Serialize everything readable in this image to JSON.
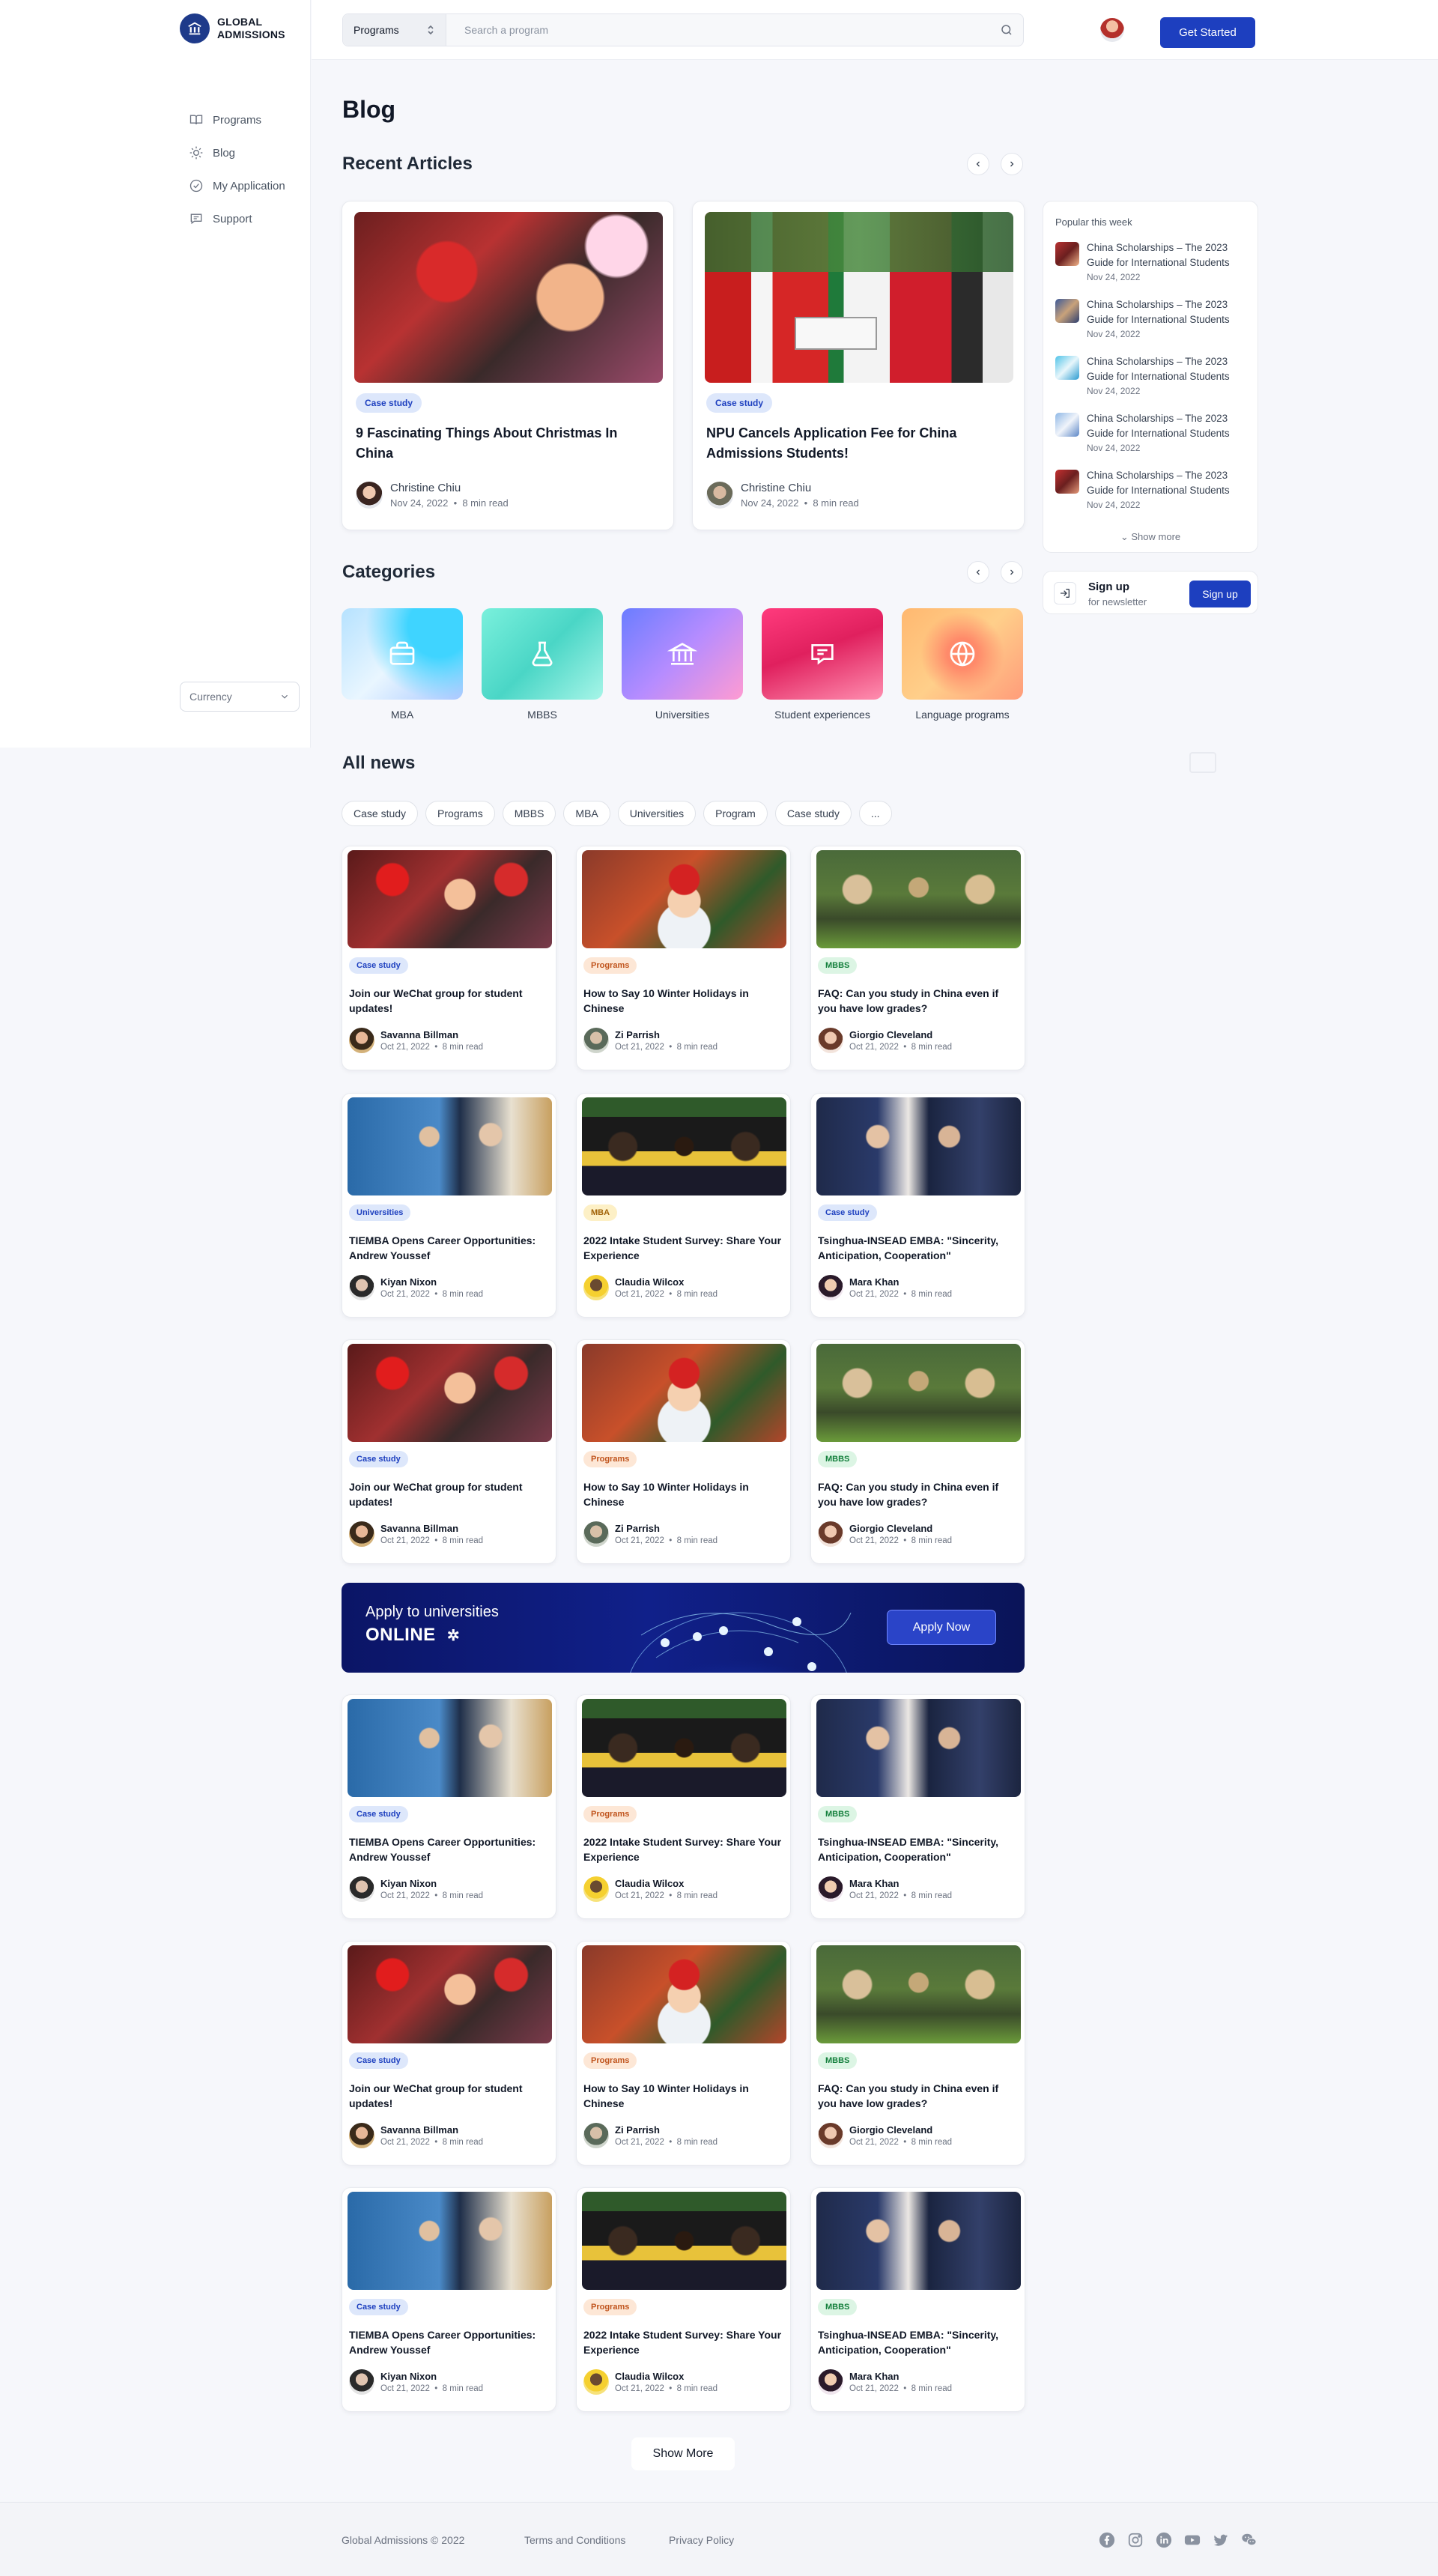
{
  "brand": {
    "line1": "GLOBAL",
    "line2": "ADMISSIONS",
    "color": "#1e3a8a"
  },
  "sidebar": {
    "items": [
      {
        "label": "Programs",
        "icon": "book-icon"
      },
      {
        "label": "Blog",
        "icon": "sun-icon"
      },
      {
        "label": "My Application",
        "icon": "check-circle-icon"
      },
      {
        "label": "Support",
        "icon": "chat-icon"
      }
    ],
    "currency": "Currency"
  },
  "header": {
    "search_select": "Programs",
    "search_placeholder": "Search a program",
    "cta": "Get Started",
    "accent": "#1d3fbf"
  },
  "page_title": "Blog",
  "recent": {
    "heading": "Recent Articles",
    "articles": [
      {
        "tag": "Case study",
        "title": "9 Fascinating Things About Christmas In China",
        "author": "Christine Chiu",
        "date": "Nov 24, 2022",
        "read": "8 min read"
      },
      {
        "tag": "Case study",
        "title": "NPU Cancels Application Fee for China Admissions Students!",
        "author": "Christine Chiu",
        "date": "Nov 24, 2022",
        "read": "8 min read"
      }
    ]
  },
  "popular": {
    "title": "Popular this week",
    "items": [
      {
        "text": "China Scholarships – The 2023 Guide for International Students",
        "date": "Nov 24, 2022"
      },
      {
        "text": "China Scholarships – The 2023 Guide for International Students",
        "date": "Nov 24, 2022"
      },
      {
        "text": "China Scholarships – The 2023 Guide for International Students",
        "date": "Nov 24, 2022"
      },
      {
        "text": "China Scholarships – The 2023 Guide for International Students",
        "date": "Nov 24, 2022"
      },
      {
        "text": "China Scholarships – The 2023 Guide for International Students",
        "date": "Nov 24, 2022"
      }
    ],
    "more": "Show more"
  },
  "newsletter": {
    "title": "Sign up",
    "subtitle": "for newsletter",
    "button": "Sign up"
  },
  "categories": {
    "heading": "Categories",
    "items": [
      {
        "label": "MBA",
        "icon": "briefcase-icon"
      },
      {
        "label": "MBBS",
        "icon": "flask-icon"
      },
      {
        "label": "Universities",
        "icon": "university-icon"
      },
      {
        "label": "Student experiences",
        "icon": "message-icon"
      },
      {
        "label": "Language programs",
        "icon": "globe-icon"
      }
    ]
  },
  "all_news": {
    "heading": "All news",
    "filters": [
      "Case study",
      "Programs",
      "MBBS",
      "MBA",
      "Universities",
      "Program",
      "Case study",
      "..."
    ],
    "rows": [
      [
        {
          "tag": "Case study",
          "title": "Join our WeChat group for student updates!",
          "author": "Savanna Billman",
          "date": "Oct 21, 2022",
          "read": "8 min read"
        },
        {
          "tag": "Programs",
          "title": "How to Say 10 Winter Holidays in Chinese",
          "author": "Zi Parrish",
          "date": "Oct 21, 2022",
          "read": "8 min read"
        },
        {
          "tag": "MBBS",
          "title": "FAQ: Can you study in China even if you have low grades?",
          "author": "Giorgio Cleveland",
          "date": "Oct 21, 2022",
          "read": "8 min read"
        }
      ],
      [
        {
          "tag": "Universities",
          "title": "TIEMBA Opens Career Opportunities: Andrew Youssef",
          "author": "Kiyan Nixon",
          "date": "Oct 21, 2022",
          "read": "8 min read"
        },
        {
          "tag": "MBA",
          "title": "2022 Intake Student Survey: Share Your Experience",
          "author": "Claudia Wilcox",
          "date": "Oct 21, 2022",
          "read": "8 min read"
        },
        {
          "tag": "Case study",
          "title": "Tsinghua-INSEAD EMBA: \"Sincerity, Anticipation, Cooperation\"",
          "author": "Mara Khan",
          "date": "Oct 21, 2022",
          "read": "8 min read"
        }
      ],
      [
        {
          "tag": "Case study",
          "title": "Join our WeChat group for student updates!",
          "author": "Savanna Billman",
          "date": "Oct 21, 2022",
          "read": "8 min read"
        },
        {
          "tag": "Programs",
          "title": "How to Say 10 Winter Holidays in Chinese",
          "author": "Zi Parrish",
          "date": "Oct 21, 2022",
          "read": "8 min read"
        },
        {
          "tag": "MBBS",
          "title": "FAQ: Can you study in China even if you have low grades?",
          "author": "Giorgio Cleveland",
          "date": "Oct 21, 2022",
          "read": "8 min read"
        }
      ],
      [
        {
          "tag": "Case study",
          "title": "TIEMBA Opens Career Opportunities: Andrew Youssef",
          "author": "Kiyan Nixon",
          "date": "Oct 21, 2022",
          "read": "8 min read"
        },
        {
          "tag": "Programs",
          "title": "2022 Intake Student Survey: Share Your Experience",
          "author": "Claudia Wilcox",
          "date": "Oct 21, 2022",
          "read": "8 min read"
        },
        {
          "tag": "MBBS",
          "title": "Tsinghua-INSEAD EMBA: \"Sincerity, Anticipation, Cooperation\"",
          "author": "Mara Khan",
          "date": "Oct 21, 2022",
          "read": "8 min read"
        }
      ],
      [
        {
          "tag": "Case study",
          "title": "Join our WeChat group for student updates!",
          "author": "Savanna Billman",
          "date": "Oct 21, 2022",
          "read": "8 min read"
        },
        {
          "tag": "Programs",
          "title": "How to Say 10 Winter Holidays in Chinese",
          "author": "Zi Parrish",
          "date": "Oct 21, 2022",
          "read": "8 min read"
        },
        {
          "tag": "MBBS",
          "title": "FAQ: Can you study in China even if you have low grades?",
          "author": "Giorgio Cleveland",
          "date": "Oct 21, 2022",
          "read": "8 min read"
        }
      ],
      [
        {
          "tag": "Case study",
          "title": "TIEMBA Opens Career Opportunities: Andrew Youssef",
          "author": "Kiyan Nixon",
          "date": "Oct 21, 2022",
          "read": "8 min read"
        },
        {
          "tag": "Programs",
          "title": "2022 Intake Student Survey: Share Your Experience",
          "author": "Claudia Wilcox",
          "date": "Oct 21, 2022",
          "read": "8 min read"
        },
        {
          "tag": "MBBS",
          "title": "Tsinghua-INSEAD EMBA: \"Sincerity, Anticipation, Cooperation\"",
          "author": "Mara Khan",
          "date": "Oct 21, 2022",
          "read": "8 min read"
        }
      ]
    ],
    "show_more": "Show More"
  },
  "banner": {
    "line1": "Apply to universities",
    "line2": "ONLINE",
    "button": "Apply Now"
  },
  "footer": {
    "copyright": "Global Admissions © 2022",
    "terms": "Terms and Conditions",
    "privacy": "Privacy Policy",
    "social": [
      "facebook-icon",
      "instagram-icon",
      "linkedin-icon",
      "youtube-icon",
      "twitter-icon",
      "wechat-icon"
    ]
  }
}
